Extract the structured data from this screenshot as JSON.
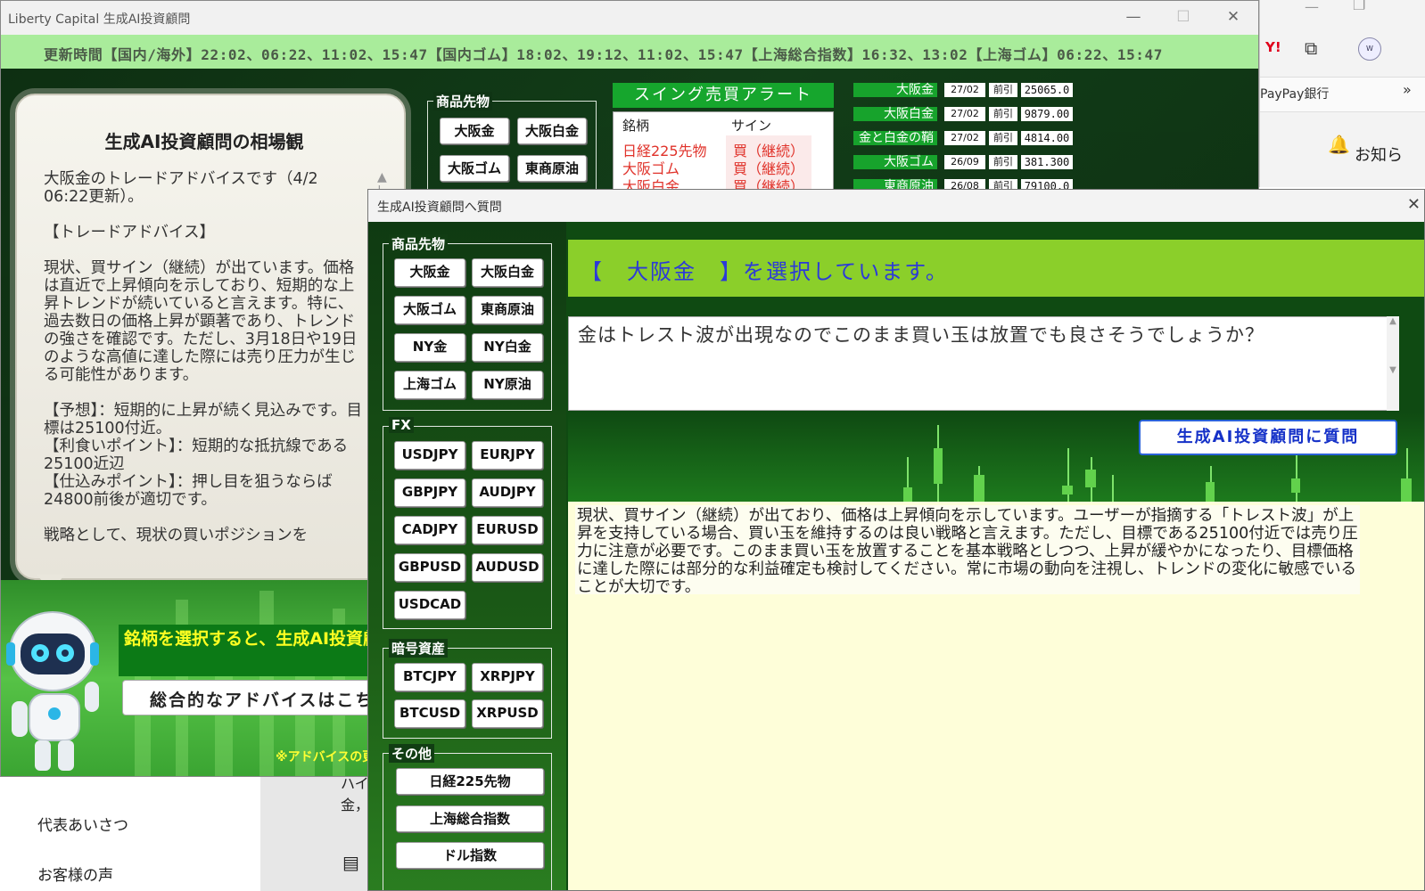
{
  "main_window": {
    "title": "Liberty Capital 生成AI投資顧問",
    "ticker": "更新時間【国内/海外】22:02、06:22、11:02、15:47【国内ゴム】18:02、19:12、11:02、15:47【上海総合指数】16:32、13:02【上海ゴム】06:22、15:47",
    "bubble": {
      "title": "生成AI投資顧問の相場観",
      "text": "大阪金のトレードアドバイスです（4/2 06:22更新）。\n\n【トレードアドバイス】\n\n現状、買サイン（継続）が出ています。価格は直近で上昇傾向を示しており、短期的な上昇トレンドが続いていると言えます。特に、過去数日の価格上昇が顕著であり、トレンドの強さを確認です。ただし、3月18日や19日のような高値に達した際には売り圧力が生じる可能性があります。\n\n【予想】：短期的に上昇が続く見込みです。目標は25100付近。\n【利食いポイント】：短期的な抵抗線である25100近辺\n【仕込みポイント】：押し目を狙うならば24800前後が適切です。\n\n戦略として、現状の買いポジションを"
    },
    "hint": "銘柄を選択すると、生成AI投資顧問からのアドバイスが表示されます。",
    "overall_button": "総合的なアドバイスはこち",
    "footnote": "※アドバイスの更",
    "commodity_group": {
      "label": "商品先物",
      "buttons": [
        "大阪金",
        "大阪白金",
        "大阪ゴム",
        "東商原油"
      ]
    },
    "alert": {
      "title": "スイング売買アラート",
      "col_symbol": "銘柄",
      "col_sign": "サイン",
      "rows": [
        {
          "symbol": "日経225先物",
          "sign": "買（継続）"
        },
        {
          "symbol": "大阪ゴム",
          "sign": "買（継続）"
        },
        {
          "symbol": "大阪白金",
          "sign": "買（継続）"
        }
      ]
    },
    "quotes": [
      {
        "name": "大阪金",
        "date": "27/02",
        "kind": "前引",
        "value": "25065.0"
      },
      {
        "name": "大阪白金",
        "date": "27/02",
        "kind": "前引",
        "value": "9879.00"
      },
      {
        "name": "金と白金の鞘",
        "date": "27/02",
        "kind": "前引",
        "value": "4814.00"
      },
      {
        "name": "大阪ゴム",
        "date": "26/09",
        "kind": "前引",
        "value": "381.300"
      },
      {
        "name": "東商原油",
        "date": "26/08",
        "kind": "前引",
        "value": "79100.0"
      }
    ]
  },
  "browser": {
    "bank_link": "PayPay銀行",
    "notice": "お知ら",
    "left_items": [
      "代表あいさつ",
      "お客様の声"
    ],
    "mid_fragments": [
      "ハイ",
      "金，"
    ]
  },
  "question_window": {
    "title": "生成AI投資顧問へ質問",
    "groups": [
      {
        "label": "商品先物",
        "buttons": [
          "大阪金",
          "大阪白金",
          "大阪ゴム",
          "東商原油",
          "NY金",
          "NY白金",
          "上海ゴム",
          "NY原油"
        ]
      },
      {
        "label": "FX",
        "buttons": [
          "USDJPY",
          "EURJPY",
          "GBPJPY",
          "AUDJPY",
          "CADJPY",
          "EURUSD",
          "GBPUSD",
          "AUDUSD",
          "USDCAD"
        ]
      },
      {
        "label": "暗号資産",
        "buttons": [
          "BTCJPY",
          "XRPJPY",
          "BTCUSD",
          "XRPUSD"
        ]
      },
      {
        "label": "その他",
        "buttons": [
          "日経225先物",
          "上海総合指数",
          "ドル指数"
        ]
      }
    ],
    "selected_banner": "【　大阪金　】を選択しています。",
    "question_text": "金はトレスト波が出現なのでこのまま買い玉は放置でも良さそうでしょうか？",
    "ask_button": "生成AI投資顧問に質問",
    "answer": "現状、買サイン（継続）が出ており、価格は上昇傾向を示しています。ユーザーが指摘する「トレスト波」が上昇を支持している場合、買い玉を維持するのは良い戦略と言えます。ただし、目標である25100付近では売り圧力に注意が必要です。このまま買い玉を放置することを基本戦略としつつ、上昇が緩やかになったり、目標価格に達した際には部分的な利益確定も検討してください。常に市場の動向を注視し、トレンドの変化に敏感でいることが大切です。"
  }
}
